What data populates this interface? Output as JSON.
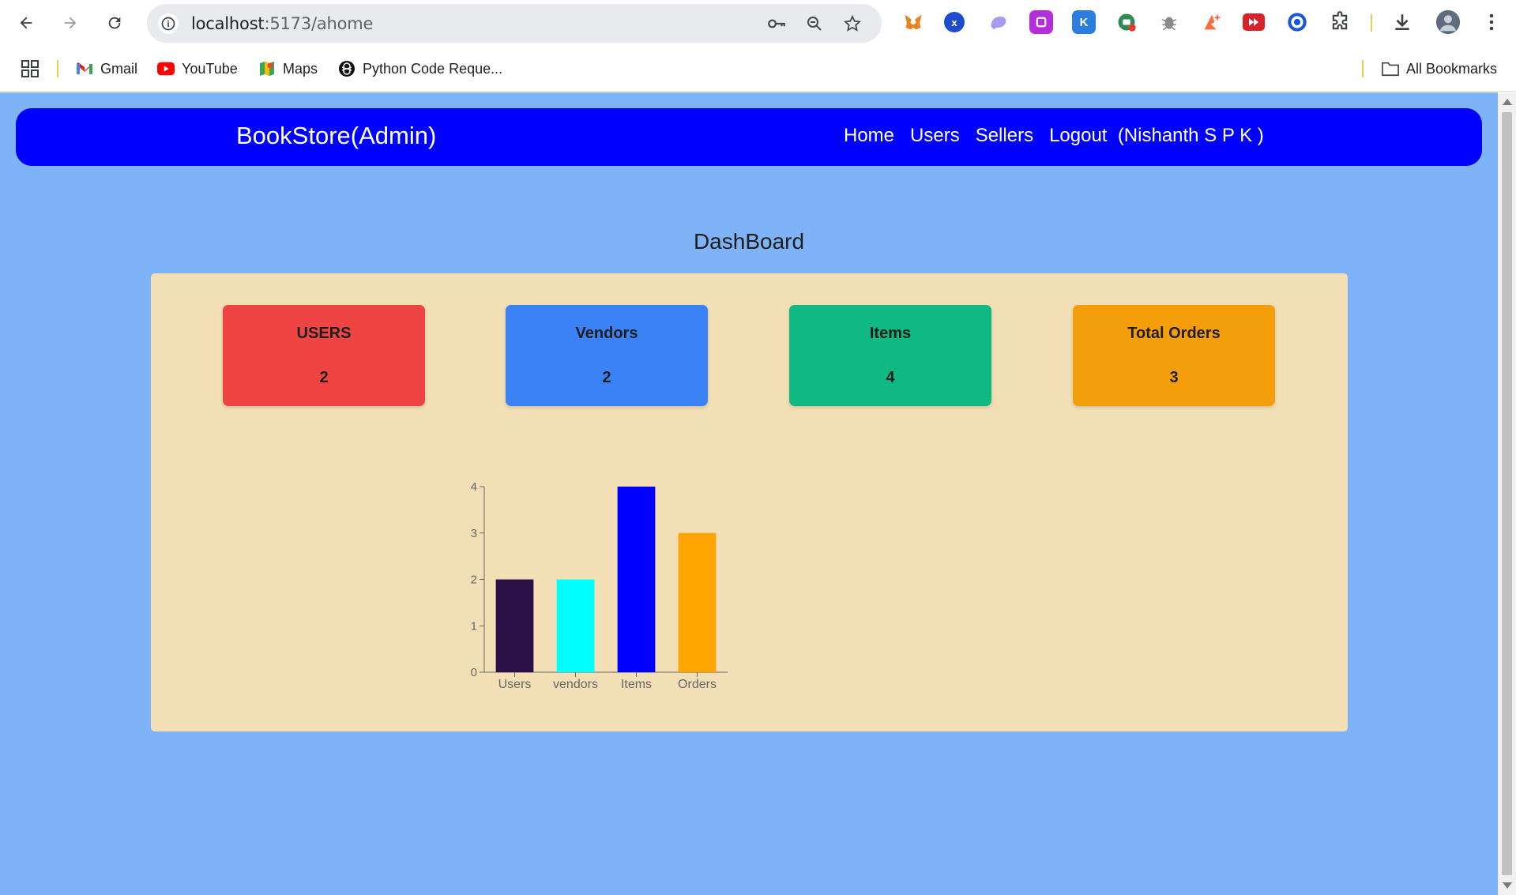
{
  "browser": {
    "url_host": "localhost",
    "url_path": ":5173/ahome",
    "bookmarks": [
      {
        "label": "Gmail",
        "icon": "gmail-icon"
      },
      {
        "label": "YouTube",
        "icon": "youtube-icon"
      },
      {
        "label": "Maps",
        "icon": "maps-icon"
      },
      {
        "label": "Python Code Reque...",
        "icon": "chatgpt-icon"
      }
    ],
    "all_bookmarks": "All Bookmarks"
  },
  "navbar": {
    "brand": "BookStore(Admin)",
    "links": [
      "Home",
      "Users",
      "Sellers",
      "Logout"
    ],
    "user": "(Nishanth S P K )",
    "bg_color": "#0000fe"
  },
  "page": {
    "title": "DashBoard",
    "background": "#7fb3f7",
    "panel_color": "#f3dfb5"
  },
  "cards": [
    {
      "label": "USERS",
      "value": "2",
      "color": "#ef4444"
    },
    {
      "label": "Vendors",
      "value": "2",
      "color": "#3b82f6"
    },
    {
      "label": "Items",
      "value": "4",
      "color": "#10b981"
    },
    {
      "label": "Total Orders",
      "value": "3",
      "color": "#f59e0b"
    }
  ],
  "chart_data": {
    "type": "bar",
    "categories": [
      "Users",
      "vendors",
      "Items",
      "Orders"
    ],
    "values": [
      2,
      2,
      4,
      3
    ],
    "bar_colors": [
      "#2a1045",
      "#00ffff",
      "#0000ff",
      "#ffa500"
    ],
    "ylim": [
      0,
      4
    ],
    "yticks": [
      0,
      1,
      2,
      3,
      4
    ],
    "legend": "value",
    "legend_color": "#8884d8",
    "grid": false
  }
}
